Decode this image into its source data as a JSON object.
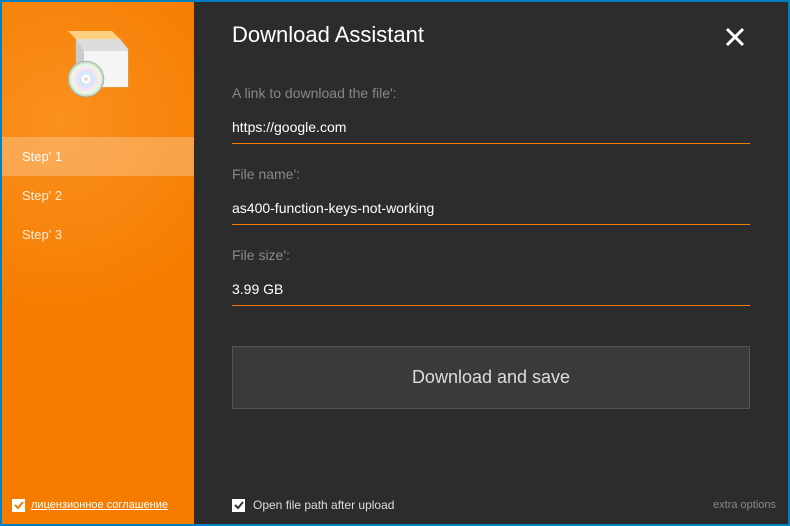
{
  "header": {
    "title": "Download Assistant"
  },
  "sidebar": {
    "steps": [
      {
        "label": "Step' 1",
        "active": true
      },
      {
        "label": "Step' 2",
        "active": false
      },
      {
        "label": "Step' 3",
        "active": false
      }
    ]
  },
  "fields": {
    "url": {
      "label": "A link to download the file':",
      "value": "https://google.com"
    },
    "filename": {
      "label": "File name':",
      "value": "as400-function-keys-not-working"
    },
    "filesize": {
      "label": "File size':",
      "value": "3.99 GB"
    }
  },
  "buttons": {
    "download": "Download and save"
  },
  "footer": {
    "license_label": "лицензионное соглашение",
    "open_path_label": "Open file path after upload",
    "extra_options": "extra options"
  }
}
